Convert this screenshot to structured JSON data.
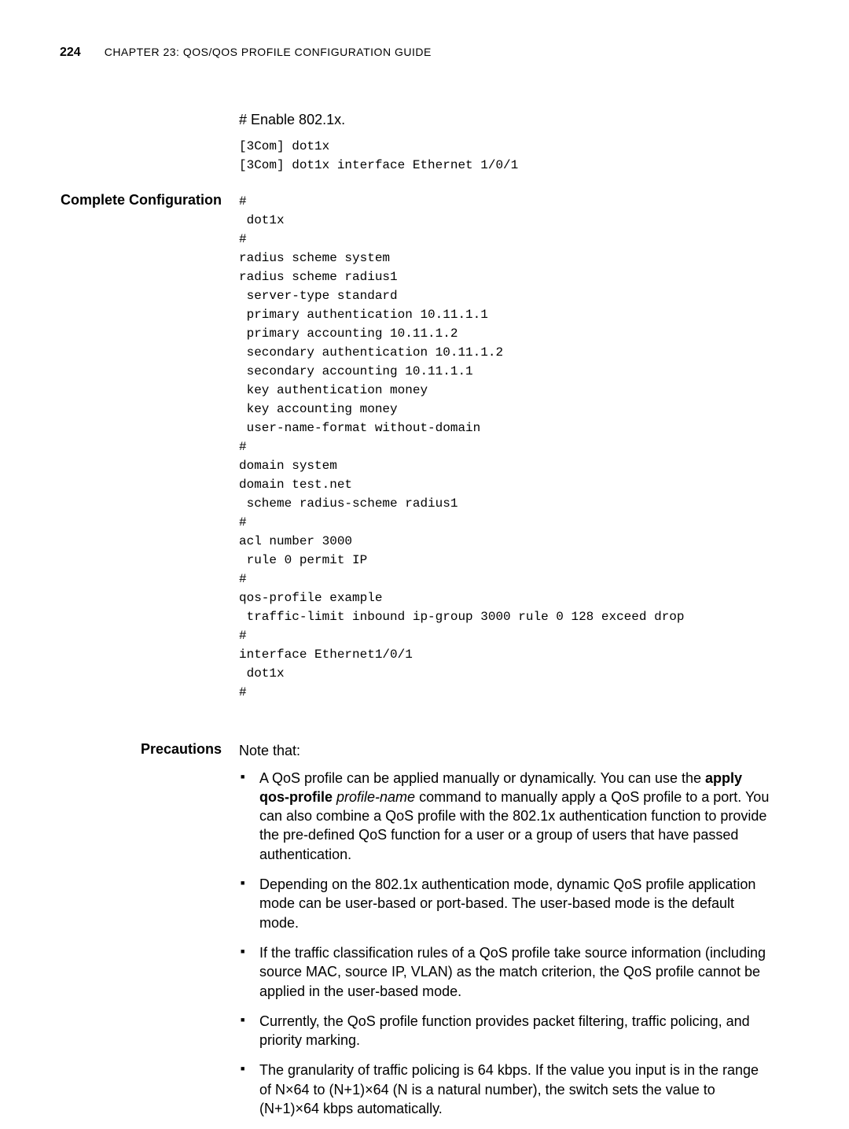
{
  "header": {
    "page_number": "224",
    "chapter_prefix": "C",
    "chapter_rest": "HAPTER",
    "chapter_num": " 23: Q",
    "chapter_abbr1": "O",
    "chapter_s1": "S/Q",
    "chapter_abbr2": "O",
    "chapter_s2": "S P",
    "chapter_rofile": "ROFILE",
    "chapter_config": " C",
    "chapter_onfig": "ONFIGURATION",
    "chapter_guide": " G",
    "chapter_uide": "UIDE",
    "chapter_full": "CHAPTER 23: QOS/QOS PROFILE CONFIGURATION GUIDE"
  },
  "intro": {
    "enable_text": "# Enable 802.1x.",
    "code1": "[3Com] dot1x\n[3Com] dot1x interface Ethernet 1/0/1"
  },
  "complete_config": {
    "label": "Complete Configuration",
    "code": "#\n dot1x\n#\nradius scheme system\nradius scheme radius1\n server-type standard\n primary authentication 10.11.1.1\n primary accounting 10.11.1.2\n secondary authentication 10.11.1.2\n secondary accounting 10.11.1.1\n key authentication money\n key accounting money\n user-name-format without-domain\n#\ndomain system\ndomain test.net\n scheme radius-scheme radius1\n#\nacl number 3000\n rule 0 permit IP\n#\nqos-profile example\n traffic-limit inbound ip-group 3000 rule 0 128 exceed drop\n#\ninterface Ethernet1/0/1\n dot1x\n#"
  },
  "precautions": {
    "label": "Precautions",
    "intro": "Note that:",
    "bullets": {
      "b1_pre": "A QoS profile can be applied manually or dynamically. You can use the ",
      "b1_bold": "apply qos-profile",
      "b1_space": " ",
      "b1_italic": "profile-name",
      "b1_post": " command to manually apply a QoS profile to a port. You can also combine a QoS profile with the 802.1x authentication function to provide the pre-defined QoS function for a user or a group of users that have passed authentication.",
      "b2": "Depending on the 802.1x authentication mode, dynamic QoS profile application mode can be user-based or port-based. The user-based mode is the default mode.",
      "b3": "If the traffic classification rules of a QoS profile take source information (including source MAC, source IP, VLAN) as the match criterion, the QoS profile cannot be applied in the user-based mode.",
      "b4": "Currently, the QoS profile function provides packet filtering, traffic policing, and priority marking.",
      "b5": "The granularity of traffic policing is 64 kbps. If the value you input is in the range of N×64 to (N+1)×64 (N is a natural number), the switch sets the value to (N+1)×64 kbps automatically."
    }
  }
}
